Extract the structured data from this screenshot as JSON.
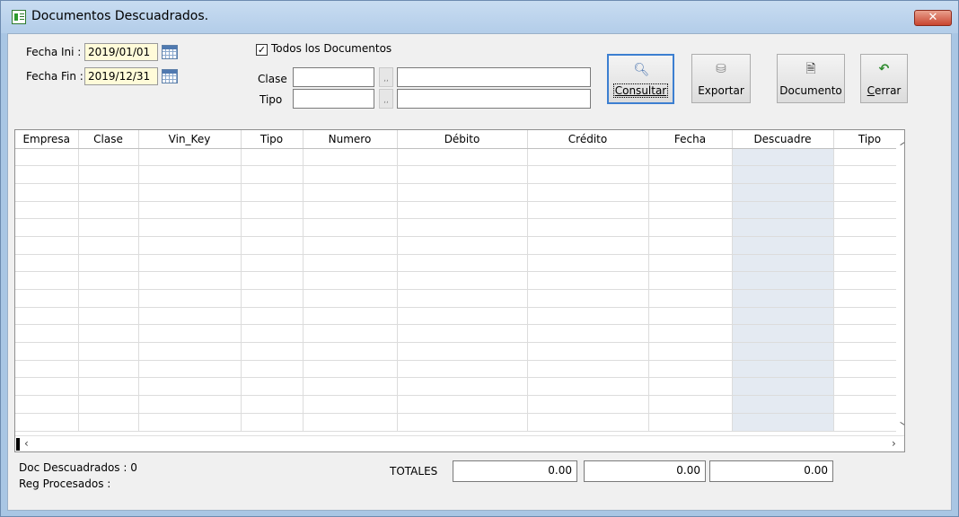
{
  "window": {
    "title": "Documentos Descuadrados.",
    "close_glyph": "✕"
  },
  "filters": {
    "fecha_ini_label": "Fecha Ini :",
    "fecha_ini_value": "2019/01/01",
    "fecha_fin_label": "Fecha Fin :",
    "fecha_fin_value": "2019/12/31",
    "todos_label": "Todos los Documentos",
    "todos_checked": "✓",
    "clase_label": "Clase",
    "tipo_label": "Tipo",
    "dots": ",,"
  },
  "toolbar": {
    "consultar": "Consultar",
    "exportar": "Exportar",
    "documento": "Documento",
    "cerrar_underlined": "C",
    "cerrar_rest": "errar"
  },
  "grid": {
    "columns": [
      "Empresa",
      "Clase",
      "Vin_Key",
      "Tipo",
      "Numero",
      "Débito",
      "Crédito",
      "Fecha",
      "Descuadre",
      "Tipo"
    ],
    "row_count": 16
  },
  "footer": {
    "doc_descuadrados": "Doc Descuadrados : 0",
    "reg_procesados": "Reg Procesados :",
    "totales_label": "TOTALES",
    "total_debito": "0.00",
    "total_credito": "0.00",
    "total_descuadre": "0.00"
  },
  "colors": {
    "titlebar": "#b9d1ea",
    "descuadre_column": "#e4eaf2",
    "date_field": "#fffbd9"
  }
}
